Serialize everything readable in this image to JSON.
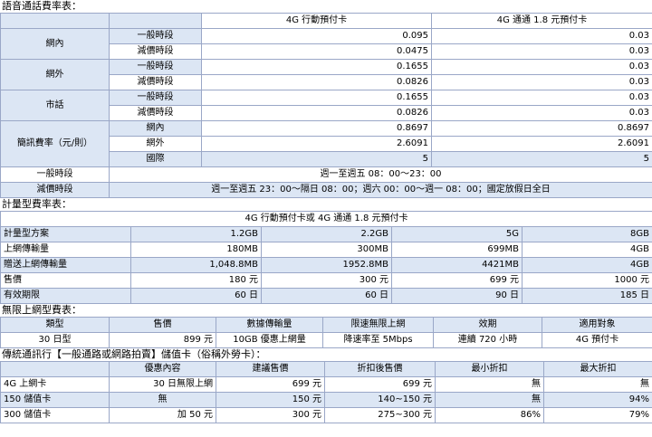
{
  "voice": {
    "title": "語音通話費率表：",
    "col1": "4G 行動預付卡",
    "col2": "4G  通通 1.8 元預付卡",
    "groups": [
      {
        "name": "網內",
        "rows": [
          {
            "label": "一般時段",
            "v1": "0.095",
            "v2": "0.03"
          },
          {
            "label": "減價時段",
            "v1": "0.0475",
            "v2": "0.03"
          }
        ]
      },
      {
        "name": "網外",
        "rows": [
          {
            "label": "一般時段",
            "v1": "0.1655",
            "v2": "0.03"
          },
          {
            "label": "減價時段",
            "v1": "0.0826",
            "v2": "0.03"
          }
        ]
      },
      {
        "name": "市話",
        "rows": [
          {
            "label": "一般時段",
            "v1": "0.1655",
            "v2": "0.03"
          },
          {
            "label": "減價時段",
            "v1": "0.0826",
            "v2": "0.03"
          }
        ]
      },
      {
        "name": "簡訊費率（元/則）",
        "rows": [
          {
            "label": "網內",
            "v1": "0.8697",
            "v2": "0.8697"
          },
          {
            "label": "網外",
            "v1": "2.6091",
            "v2": "2.6091"
          },
          {
            "label": "國際",
            "v1": "5",
            "v2": "5"
          }
        ]
      }
    ],
    "periods": [
      {
        "label": "一般時段",
        "value": "週一至週五 08：00～23：00"
      },
      {
        "label": "減價時段",
        "value": "週一至週五 23：00～隔日 08：00；週六 00：00～週一 08：00；國定放假日全日"
      }
    ]
  },
  "metered": {
    "title": "計量型費率表：",
    "header": "4G 行動預付卡或 4G  通通 1.8 元預付卡",
    "rows": [
      {
        "label": "計量型方案",
        "values": [
          "1.2GB",
          "2.2GB",
          "5G",
          "8GB"
        ]
      },
      {
        "label": "上網傳輸量",
        "values": [
          "180MB",
          "300MB",
          "699MB",
          "4GB"
        ]
      },
      {
        "label": "贈送上網傳輸量",
        "values": [
          "1,048.8MB",
          "1952.8MB",
          "4421MB",
          "4GB"
        ]
      },
      {
        "label": "售價",
        "values": [
          "180 元",
          "300 元",
          "699 元",
          "1000 元"
        ]
      },
      {
        "label": "有效期限",
        "values": [
          "60 日",
          "60 日",
          "90 日",
          "185 日"
        ]
      }
    ]
  },
  "unlimited": {
    "title": "無限上網型費表：",
    "headers": [
      "類型",
      "售價",
      "數據傳輸量",
      "限速無限上網",
      "效期",
      "適用對象"
    ],
    "row": [
      "30 日型",
      "899 元",
      "10GB 優惠上網量",
      "降速率至 5Mbps",
      "連續 720 小時",
      "4G 預付卡"
    ]
  },
  "stored": {
    "title": "傳統通訊行【一般通路或網路拍賣】儲值卡（俗稱外勞卡）：",
    "headers": [
      "",
      "優惠內容",
      "建議售價",
      "折扣後售價",
      "最小折扣",
      "最大折扣"
    ],
    "rows": [
      [
        "4G  上網卡",
        "30 日無限上網",
        "699 元",
        "699 元",
        "無",
        "無"
      ],
      [
        "150 儲值卡",
        "無",
        "150 元",
        "140~150 元",
        "無",
        "94%"
      ],
      [
        "300 儲值卡",
        "加 50 元",
        "300 元",
        "275~300 元",
        "86%",
        "79%"
      ]
    ]
  }
}
